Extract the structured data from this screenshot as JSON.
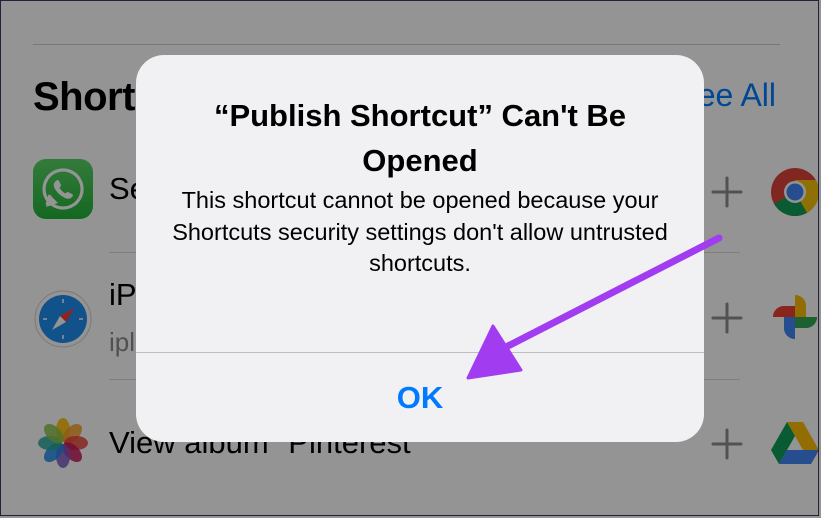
{
  "background": {
    "section_title": "Short",
    "see_all": "See All",
    "rows": [
      {
        "title": "Se",
        "subtitle": "",
        "app_icon": "whatsapp-icon",
        "service_icon": "chrome-icon"
      },
      {
        "title": "iP",
        "subtitle": "ipl",
        "ellipsis": "...",
        "app_icon": "safari-icon",
        "service_icon": "google-photos-icon"
      },
      {
        "title": "View album \"Pinterest",
        "subtitle": "",
        "app_icon": "photos-icon",
        "service_icon": "google-drive-icon"
      }
    ]
  },
  "alert": {
    "title": "“Publish Shortcut” Can't Be Opened",
    "message": "This shortcut cannot be opened because your Shortcuts security settings don't allow untrusted shortcuts.",
    "button_label": "OK"
  },
  "colors": {
    "accent": "#007aff",
    "annotation_arrow": "#a13cf0",
    "alert_background": "#f1f1f3",
    "dim_overlay": "rgba(0,0,0,0.42)"
  }
}
